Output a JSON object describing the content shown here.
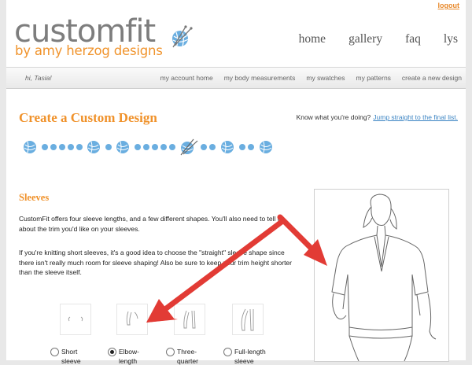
{
  "header": {
    "logout": "logout",
    "logo_main": "customfit",
    "logo_sub": "by amy herzog designs",
    "nav": [
      "home",
      "gallery",
      "faq",
      "lys"
    ]
  },
  "subnav": {
    "greeting": "hi, Tasia!",
    "links": [
      "my account home",
      "my body measurements",
      "my swatches",
      "my patterns",
      "create a new design"
    ]
  },
  "main": {
    "title": "Create a Custom Design",
    "know_text": "Know what you're doing?",
    "know_link": "Jump straight to the final list.",
    "section_heading": "Sleeves",
    "paragraph1": "CustomFit offers four sleeve lengths, and a few different shapes. You'll also need to tell us about the trim you'd like on your sleeves.",
    "paragraph2": "If you're knitting short sleeves, it's a good idea to choose the \"straight\" sleeve shape since there isn't really much room for sleeve shaping! Also be sure to keep your trim height shorter than the sleeve itself.",
    "sleeve_options": [
      {
        "line1": "Short",
        "line2": "sleeve",
        "selected": false
      },
      {
        "line1": "Elbow-",
        "line2": "length",
        "selected": true
      },
      {
        "line1": "Three-",
        "line2": "quarter",
        "selected": false
      },
      {
        "line1": "Full-length",
        "line2": "sleeve",
        "selected": false
      }
    ]
  },
  "colors": {
    "accent_orange": "#f0922b",
    "link_blue": "#3b84c3",
    "progress_blue": "#6aaee0",
    "arrow_red": "#e23b35"
  },
  "icons": [
    "yarn-ball-needles-icon",
    "yarn-ball-icon",
    "sleeve-icon",
    "sweater-sketch"
  ]
}
